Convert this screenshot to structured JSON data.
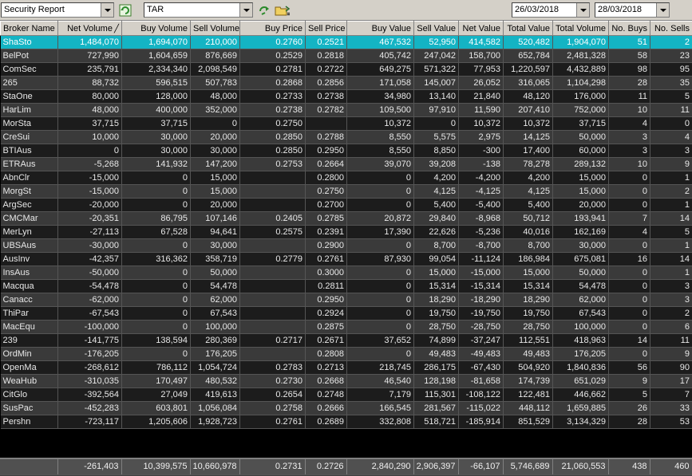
{
  "toolbar": {
    "report_type": "Security Report",
    "security_code": "TAR",
    "date_from": "26/03/2018",
    "date_to": "28/03/2018"
  },
  "columns": [
    "Broker Name",
    "Net Volume",
    "Buy Volume",
    "Sell Volume",
    "Buy Price",
    "Sell Price",
    "Buy Value",
    "Sell Value",
    "Net Value",
    "Total Value",
    "Total Volume",
    "No. Buys",
    "No. Sells"
  ],
  "sort_mark": "╱",
  "rows": [
    [
      "ShaSto",
      "1,484,070",
      "1,694,070",
      "210,000",
      "0.2760",
      "0.2521",
      "467,532",
      "52,950",
      "414,582",
      "520,482",
      "1,904,070",
      "51",
      "2"
    ],
    [
      "BelPot",
      "727,990",
      "1,604,659",
      "876,669",
      "0.2529",
      "0.2818",
      "405,742",
      "247,042",
      "158,700",
      "652,784",
      "2,481,328",
      "58",
      "23"
    ],
    [
      "ComSec",
      "235,791",
      "2,334,340",
      "2,098,549",
      "0.2781",
      "0.2722",
      "649,275",
      "571,322",
      "77,953",
      "1,220,597",
      "4,432,889",
      "98",
      "95"
    ],
    [
      "265",
      "88,732",
      "596,515",
      "507,783",
      "0.2868",
      "0.2856",
      "171,058",
      "145,007",
      "26,052",
      "316,065",
      "1,104,298",
      "28",
      "35"
    ],
    [
      "StaOne",
      "80,000",
      "128,000",
      "48,000",
      "0.2733",
      "0.2738",
      "34,980",
      "13,140",
      "21,840",
      "48,120",
      "176,000",
      "11",
      "5"
    ],
    [
      "HarLim",
      "48,000",
      "400,000",
      "352,000",
      "0.2738",
      "0.2782",
      "109,500",
      "97,910",
      "11,590",
      "207,410",
      "752,000",
      "10",
      "11"
    ],
    [
      "MorSta",
      "37,715",
      "37,715",
      "0",
      "0.2750",
      "",
      "10,372",
      "0",
      "10,372",
      "10,372",
      "37,715",
      "4",
      "0"
    ],
    [
      "CreSui",
      "10,000",
      "30,000",
      "20,000",
      "0.2850",
      "0.2788",
      "8,550",
      "5,575",
      "2,975",
      "14,125",
      "50,000",
      "3",
      "4"
    ],
    [
      "BTIAus",
      "0",
      "30,000",
      "30,000",
      "0.2850",
      "0.2950",
      "8,550",
      "8,850",
      "-300",
      "17,400",
      "60,000",
      "3",
      "3"
    ],
    [
      "ETRAus",
      "-5,268",
      "141,932",
      "147,200",
      "0.2753",
      "0.2664",
      "39,070",
      "39,208",
      "-138",
      "78,278",
      "289,132",
      "10",
      "9"
    ],
    [
      "AbnClr",
      "-15,000",
      "0",
      "15,000",
      "",
      "0.2800",
      "0",
      "4,200",
      "-4,200",
      "4,200",
      "15,000",
      "0",
      "1"
    ],
    [
      "MorgSt",
      "-15,000",
      "0",
      "15,000",
      "",
      "0.2750",
      "0",
      "4,125",
      "-4,125",
      "4,125",
      "15,000",
      "0",
      "2"
    ],
    [
      "ArgSec",
      "-20,000",
      "0",
      "20,000",
      "",
      "0.2700",
      "0",
      "5,400",
      "-5,400",
      "5,400",
      "20,000",
      "0",
      "1"
    ],
    [
      "CMCMar",
      "-20,351",
      "86,795",
      "107,146",
      "0.2405",
      "0.2785",
      "20,872",
      "29,840",
      "-8,968",
      "50,712",
      "193,941",
      "7",
      "14"
    ],
    [
      "MerLyn",
      "-27,113",
      "67,528",
      "94,641",
      "0.2575",
      "0.2391",
      "17,390",
      "22,626",
      "-5,236",
      "40,016",
      "162,169",
      "4",
      "5"
    ],
    [
      "UBSAus",
      "-30,000",
      "0",
      "30,000",
      "",
      "0.2900",
      "0",
      "8,700",
      "-8,700",
      "8,700",
      "30,000",
      "0",
      "1"
    ],
    [
      "AusInv",
      "-42,357",
      "316,362",
      "358,719",
      "0.2779",
      "0.2761",
      "87,930",
      "99,054",
      "-11,124",
      "186,984",
      "675,081",
      "16",
      "14"
    ],
    [
      "InsAus",
      "-50,000",
      "0",
      "50,000",
      "",
      "0.3000",
      "0",
      "15,000",
      "-15,000",
      "15,000",
      "50,000",
      "0",
      "1"
    ],
    [
      "Macqua",
      "-54,478",
      "0",
      "54,478",
      "",
      "0.2811",
      "0",
      "15,314",
      "-15,314",
      "15,314",
      "54,478",
      "0",
      "3"
    ],
    [
      "Canacc",
      "-62,000",
      "0",
      "62,000",
      "",
      "0.2950",
      "0",
      "18,290",
      "-18,290",
      "18,290",
      "62,000",
      "0",
      "3"
    ],
    [
      "ThiPar",
      "-67,543",
      "0",
      "67,543",
      "",
      "0.2924",
      "0",
      "19,750",
      "-19,750",
      "19,750",
      "67,543",
      "0",
      "2"
    ],
    [
      "MacEqu",
      "-100,000",
      "0",
      "100,000",
      "",
      "0.2875",
      "0",
      "28,750",
      "-28,750",
      "28,750",
      "100,000",
      "0",
      "6"
    ],
    [
      "239",
      "-141,775",
      "138,594",
      "280,369",
      "0.2717",
      "0.2671",
      "37,652",
      "74,899",
      "-37,247",
      "112,551",
      "418,963",
      "14",
      "11"
    ],
    [
      "OrdMin",
      "-176,205",
      "0",
      "176,205",
      "",
      "0.2808",
      "0",
      "49,483",
      "-49,483",
      "49,483",
      "176,205",
      "0",
      "9"
    ],
    [
      "OpenMa",
      "-268,612",
      "786,112",
      "1,054,724",
      "0.2783",
      "0.2713",
      "218,745",
      "286,175",
      "-67,430",
      "504,920",
      "1,840,836",
      "56",
      "90"
    ],
    [
      "WeaHub",
      "-310,035",
      "170,497",
      "480,532",
      "0.2730",
      "0.2668",
      "46,540",
      "128,198",
      "-81,658",
      "174,739",
      "651,029",
      "9",
      "17"
    ],
    [
      "CitGlo",
      "-392,564",
      "27,049",
      "419,613",
      "0.2654",
      "0.2748",
      "7,179",
      "115,301",
      "-108,122",
      "122,481",
      "446,662",
      "5",
      "7"
    ],
    [
      "SusPac",
      "-452,283",
      "603,801",
      "1,056,084",
      "0.2758",
      "0.2666",
      "166,545",
      "281,567",
      "-115,022",
      "448,112",
      "1,659,885",
      "26",
      "33"
    ],
    [
      "Pershn",
      "-723,117",
      "1,205,606",
      "1,928,723",
      "0.2761",
      "0.2689",
      "332,808",
      "518,721",
      "-185,914",
      "851,529",
      "3,134,329",
      "28",
      "53"
    ]
  ],
  "totals": [
    "",
    "-261,403",
    "10,399,575",
    "10,660,978",
    "0.2731",
    "0.2726",
    "2,840,290",
    "2,906,397",
    "-66,107",
    "5,746,689",
    "21,060,553",
    "438",
    "460"
  ]
}
